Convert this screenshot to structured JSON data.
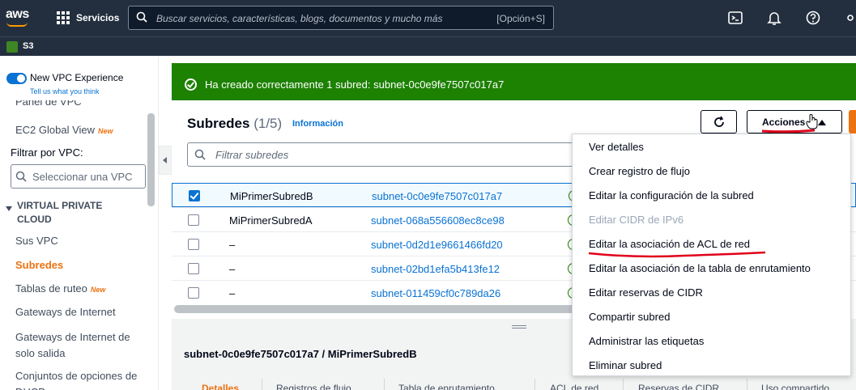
{
  "topnav": {
    "logo": "aws",
    "services_label": "Servicios",
    "search_placeholder": "Buscar servicios, características, blogs, documentos y mucho más",
    "search_shortcut": "[Opción+S]"
  },
  "subnav": {
    "service_label": "S3"
  },
  "sidebar": {
    "experience_label": "New VPC Experience",
    "tell_us_link": "Tell us what you think",
    "items_top": [
      {
        "label": "Panel de VPC"
      },
      {
        "label": "EC2 Global View",
        "badge": "New"
      }
    ],
    "filter_label": "Filtrar por VPC:",
    "vpc_select_placeholder": "Seleccionar una VPC",
    "section_title": "VIRTUAL PRIVATE CLOUD",
    "items": [
      {
        "label": "Sus VPC"
      },
      {
        "label": "Subredes"
      },
      {
        "label": "Tablas de ruteo",
        "badge": "New"
      },
      {
        "label": "Gateways de Internet"
      },
      {
        "label": "Gateways de Internet de solo salida"
      },
      {
        "label": "Conjuntos de opciones de DHCP"
      }
    ]
  },
  "flash": {
    "message": "Ha creado correctamente 1 subred: subnet-0c0e9fe7507c017a7"
  },
  "panel": {
    "title": "Subredes",
    "count": "(1/5)",
    "info_link": "Información",
    "actions_label": "Acciones",
    "filter_placeholder": "Filtrar subredes"
  },
  "rows": [
    {
      "name": "MiPrimerSubredB",
      "id": "subnet-0c0e9fe7507c017a7",
      "selected": true
    },
    {
      "name": "MiPrimerSubredA",
      "id": "subnet-068a556608ec8ce98",
      "selected": false
    },
    {
      "name": "–",
      "id": "subnet-0d2d1e9661466fd20",
      "selected": false
    },
    {
      "name": "–",
      "id": "subnet-02bd1efa5b413fe12",
      "selected": false
    },
    {
      "name": "–",
      "id": "subnet-011459cf0c789da26",
      "selected": false
    }
  ],
  "row_ellipsis": "...",
  "detail": {
    "title": "subnet-0c0e9fe7507c017a7 / MiPrimerSubredB",
    "tabs": [
      "Detalles",
      "Registros de flujo",
      "Tabla de enrutamiento",
      "ACL de red",
      "Reservas de CIDR",
      "Uso compartido"
    ]
  },
  "actions_menu": [
    {
      "label": "Ver detalles",
      "disabled": false
    },
    {
      "label": "Crear registro de flujo",
      "disabled": false
    },
    {
      "label": "Editar la configuración de la subred",
      "disabled": false
    },
    {
      "label": "Editar CIDR de IPv6",
      "disabled": true
    },
    {
      "label": "Editar la asociación de ACL de red",
      "disabled": false
    },
    {
      "label": "Editar la asociación de la tabla de enrutamiento",
      "disabled": false
    },
    {
      "label": "Editar reservas de CIDR",
      "disabled": false
    },
    {
      "label": "Compartir subred",
      "disabled": false
    },
    {
      "label": "Administrar las etiquetas",
      "disabled": false
    },
    {
      "label": "Eliminar subred",
      "disabled": false
    }
  ],
  "colors": {
    "nav_bg": "#232f3e",
    "success_green": "#1d8102",
    "link_blue": "#0972d3",
    "accent_orange": "#ec7211",
    "annotation_red": "#e0001b"
  }
}
